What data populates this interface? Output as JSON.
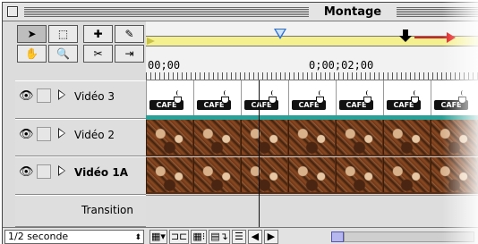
{
  "window": {
    "title": "Montage"
  },
  "tools": [
    {
      "name": "selection-tool",
      "glyph": "➤"
    },
    {
      "name": "marquee-tool",
      "glyph": "⬚"
    },
    {
      "name": "track-tool",
      "glyph": "✚"
    },
    {
      "name": "pen-tool",
      "glyph": "✎"
    },
    {
      "name": "hand-tool",
      "glyph": "✋"
    },
    {
      "name": "zoom-tool",
      "glyph": "🔍"
    },
    {
      "name": "razor-tool",
      "glyph": "✂"
    },
    {
      "name": "edge-tool",
      "glyph": "⇥"
    }
  ],
  "ruler": {
    "start_timecode": "00;00",
    "mid_timecode": "0;00;02;00"
  },
  "tracks": [
    {
      "label": "Vidéo 3",
      "clip": "CAFE",
      "bold": false
    },
    {
      "label": "Vidéo 2",
      "bold": false
    },
    {
      "label": "Vidéo 1A",
      "bold": true
    }
  ],
  "transition": {
    "label": "Transition"
  },
  "bottom": {
    "zoom_value": "1/2 seconde"
  },
  "colors": {
    "work_area": "#f5f08f",
    "marker": "#2d6fd0",
    "red_arrow": "#e21b1b",
    "teal_bar": "#2aa198",
    "scroll_thumb": "#b7b7f0"
  }
}
